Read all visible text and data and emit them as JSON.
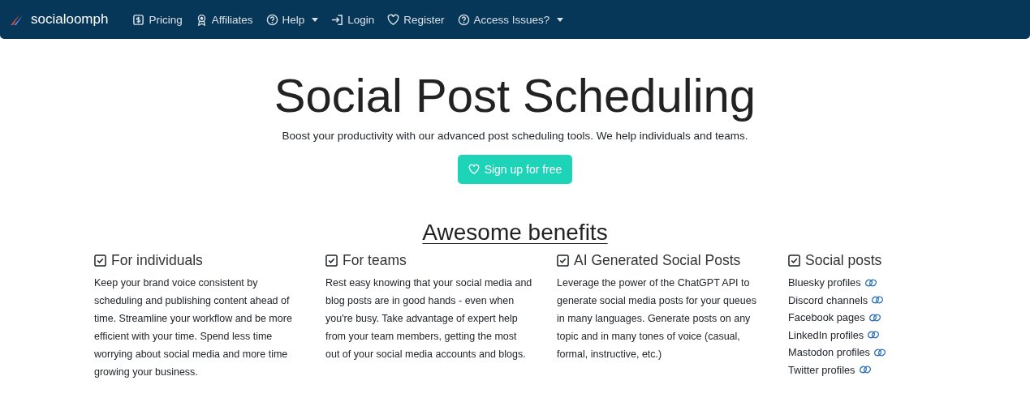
{
  "navbar": {
    "brand": "socialoomph",
    "items": [
      {
        "label": "Pricing",
        "kind": "dollar",
        "dropdown": false
      },
      {
        "label": "Affiliates",
        "kind": "award",
        "dropdown": false
      },
      {
        "label": "Help",
        "kind": "question",
        "dropdown": true
      },
      {
        "label": "Login",
        "kind": "login",
        "dropdown": false
      },
      {
        "label": "Register",
        "kind": "heart",
        "dropdown": false
      },
      {
        "label": "Access Issues?",
        "kind": "question",
        "dropdown": true
      }
    ]
  },
  "hero": {
    "title": "Social Post Scheduling",
    "subtitle": "Boost your productivity with our advanced post scheduling tools. We help individuals and teams.",
    "button": "Sign up for free"
  },
  "benefits": {
    "heading": "Awesome benefits",
    "columns": [
      {
        "kind": "text",
        "title": "For individuals",
        "text": "Keep your brand voice consistent by scheduling and publishing content ahead of time. Streamline your workflow and be more efficient with your time. Spend less time worrying about social media and more time growing your business."
      },
      {
        "kind": "text",
        "title": "For teams",
        "text": "Rest easy knowing that your social media and blog posts are in good hands - even when you're busy. Take advantage of expert help from your team members, getting the most out of your social media accounts and blogs."
      },
      {
        "kind": "text",
        "title": "AI Generated Social Posts",
        "text": "Leverage the power of the ChatGPT API to generate social media posts for your queues in many languages. Generate posts on any topic and in many tones of voice (casual, formal, instructive, etc.)"
      },
      {
        "kind": "links",
        "title": "Social posts",
        "links": [
          "Bluesky profiles",
          "Discord channels",
          "Facebook pages",
          "LinkedIn profiles",
          "Mastodon profiles",
          "Twitter profiles"
        ]
      }
    ]
  }
}
